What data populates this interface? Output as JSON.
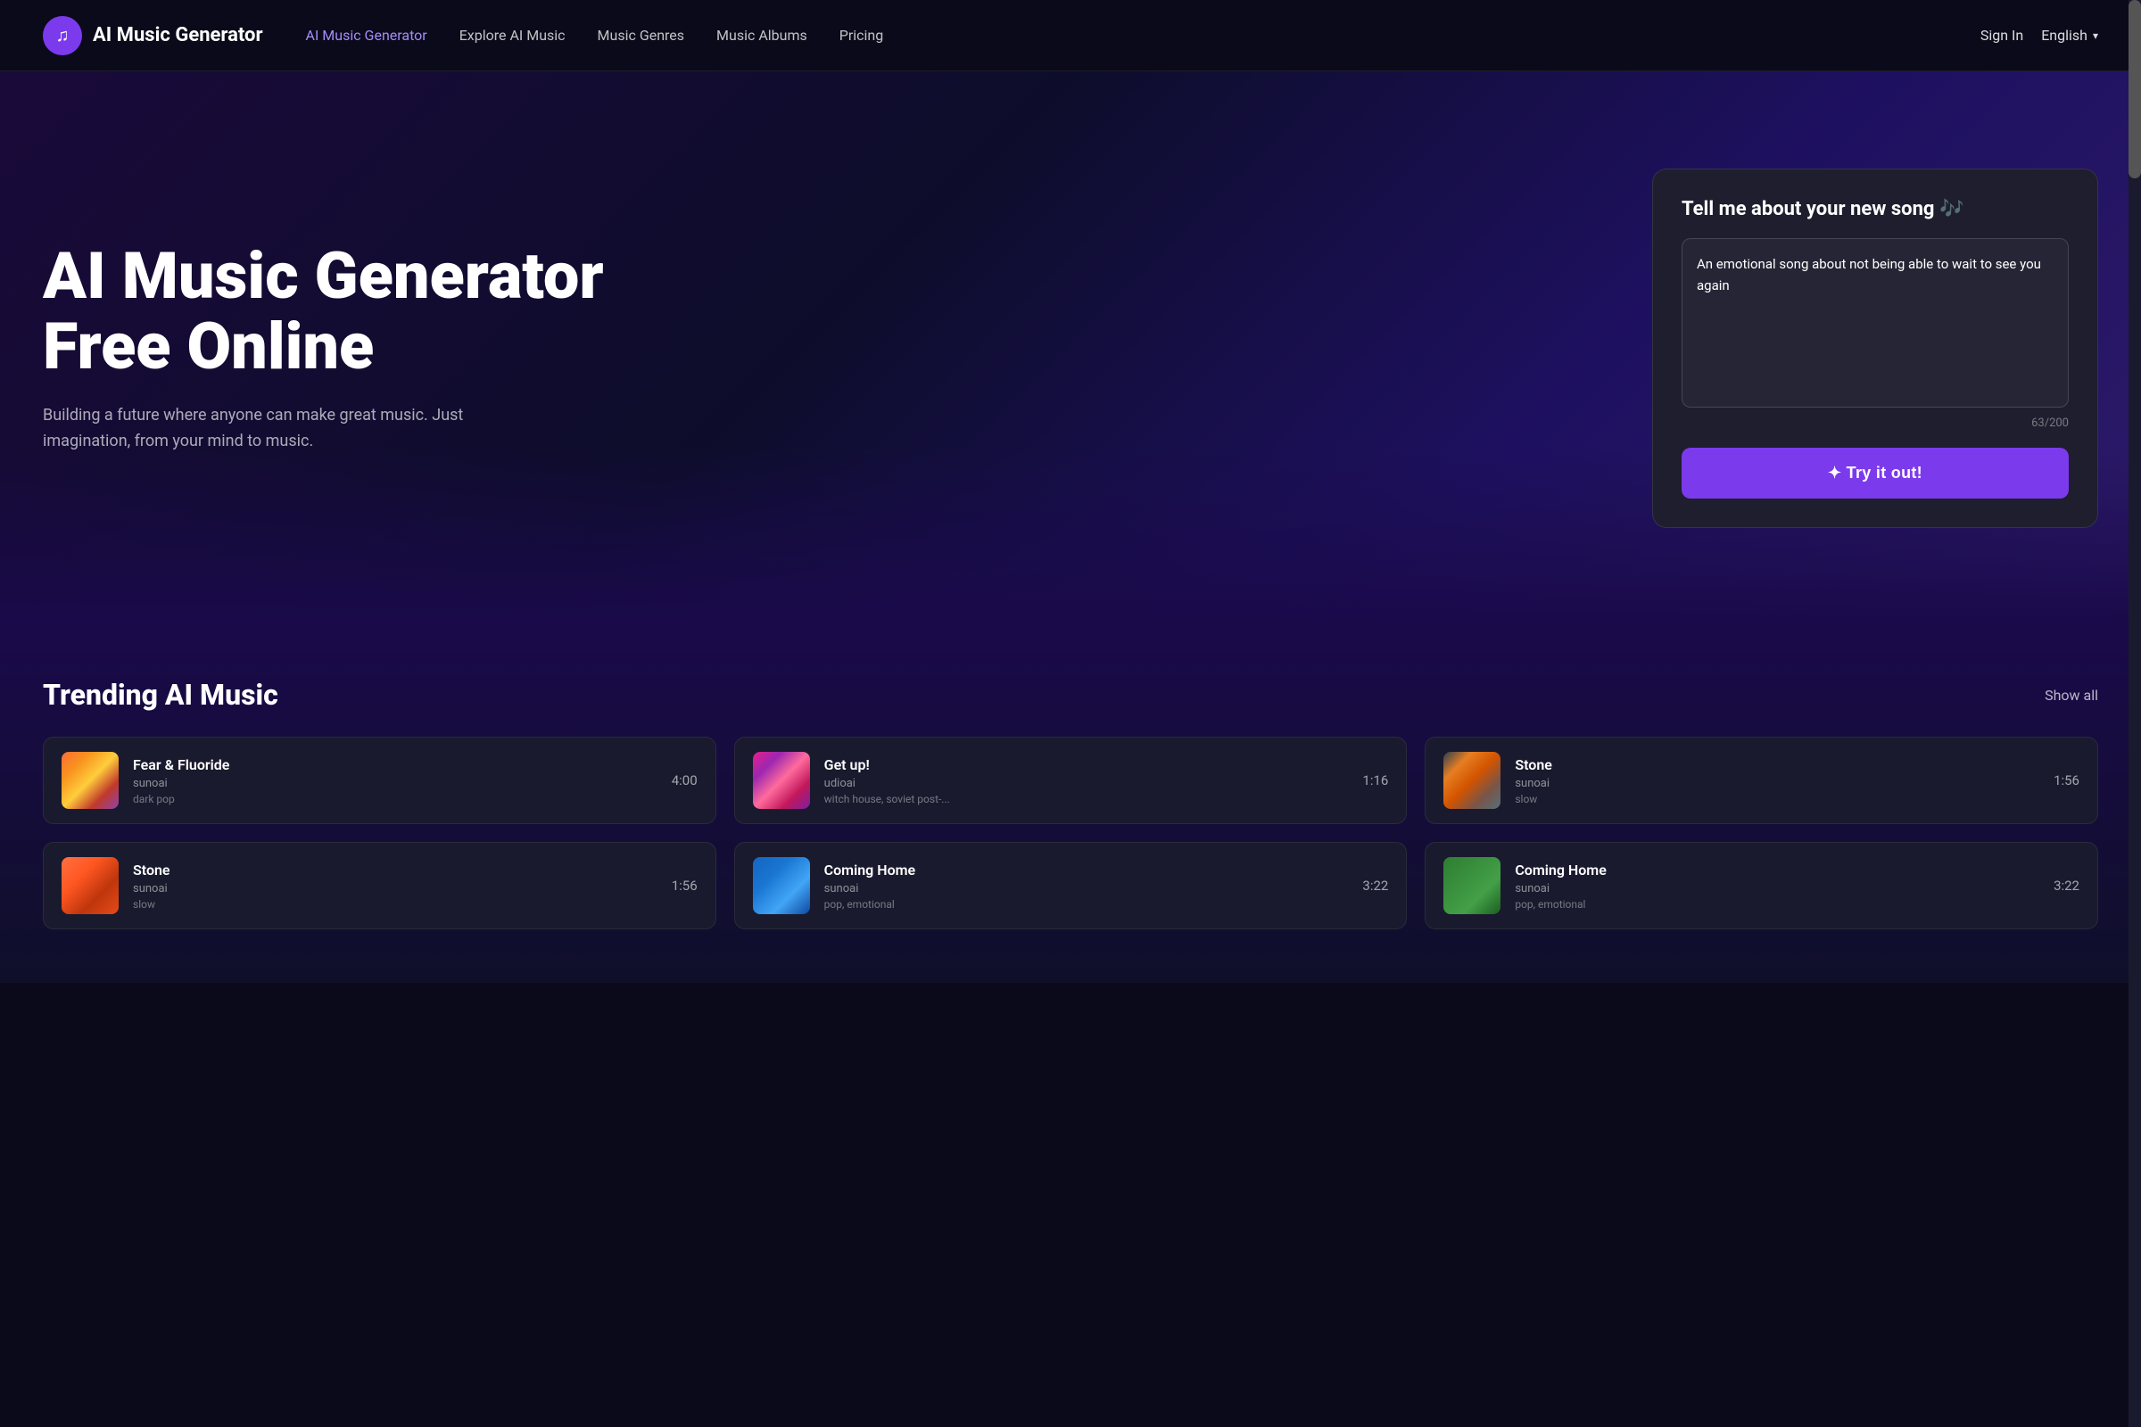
{
  "brand": {
    "logo_symbol": "♫",
    "name": "AI Music Generator"
  },
  "navbar": {
    "links": [
      {
        "id": "ai-music-generator",
        "label": "AI Music Generator",
        "active": true
      },
      {
        "id": "explore-ai-music",
        "label": "Explore AI Music",
        "active": false
      },
      {
        "id": "music-genres",
        "label": "Music Genres",
        "active": false
      },
      {
        "id": "music-albums",
        "label": "Music Albums",
        "active": false
      },
      {
        "id": "pricing",
        "label": "Pricing",
        "active": false
      }
    ],
    "sign_in": "Sign In",
    "language": "English",
    "chevron": "▾"
  },
  "hero": {
    "title": "AI Music Generator Free Online",
    "subtitle": "Building a future where anyone can make great music. Just imagination, from your mind to music."
  },
  "song_card": {
    "title": "Tell me about your new song 🎶",
    "textarea_value": "An emotional song about not being able to wait to see you again",
    "textarea_placeholder": "An emotional song about not being able to wait to see you again",
    "char_count": "63/200",
    "button_label": "✦ Try it out!"
  },
  "trending": {
    "title": "Trending AI Music",
    "show_all": "Show all",
    "songs": [
      {
        "id": "fear-fluoride",
        "name": "Fear & Fluoride",
        "artist": "sunoai",
        "genre": "dark pop",
        "duration": "4:00",
        "thumb_class": "thumb-fear"
      },
      {
        "id": "get-up",
        "name": "Get up!",
        "artist": "udioai",
        "genre": "witch house, soviet post-...",
        "duration": "1:16",
        "thumb_class": "thumb-getup"
      },
      {
        "id": "stone",
        "name": "Stone",
        "artist": "sunoai",
        "genre": "slow",
        "duration": "1:56",
        "thumb_class": "thumb-stone"
      },
      {
        "id": "stone2",
        "name": "Stone",
        "artist": "sunoai",
        "genre": "slow",
        "duration": "1:56",
        "thumb_class": "thumb-stone2"
      },
      {
        "id": "coming-home",
        "name": "Coming Home",
        "artist": "sunoai",
        "genre": "pop, emotional",
        "duration": "3:22",
        "thumb_class": "thumb-coming"
      },
      {
        "id": "coming-home2",
        "name": "Coming Home",
        "artist": "sunoai",
        "genre": "pop, emotional",
        "duration": "3:22",
        "thumb_class": "thumb-coming2"
      }
    ]
  }
}
